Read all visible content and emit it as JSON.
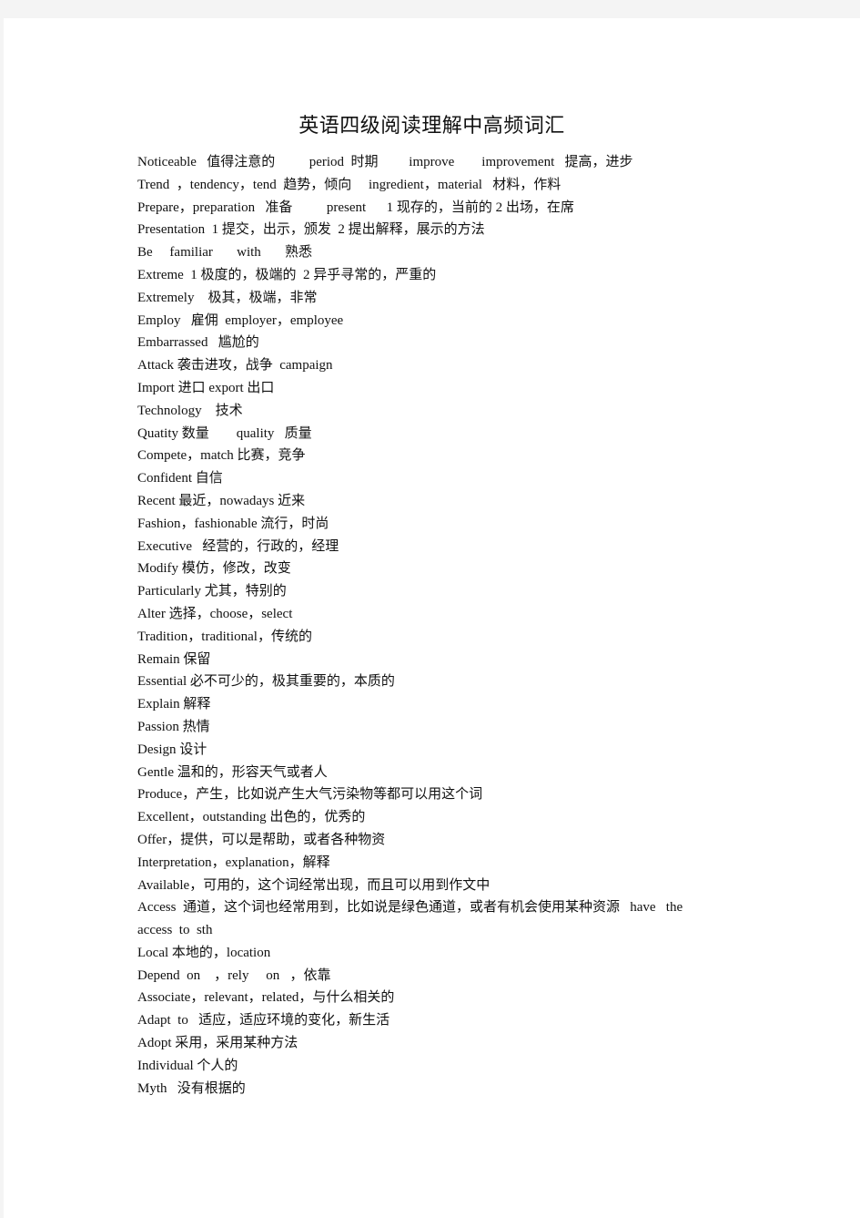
{
  "document": {
    "title": "英语四级阅读理解中高频词汇",
    "lines": [
      "Noticeable   值得注意的          period  时期         improve        improvement   提高，进步",
      "Trend  ，tendency，tend  趋势，倾向     ingredient，material   材料，作料",
      "Prepare，preparation   准备          present      1 现存的，当前的 2 出场，在席",
      "Presentation  1 提交，出示，颁发  2 提出解释，展示的方法",
      "Be     familiar       with       熟悉",
      "Extreme  1 极度的，极端的  2 异乎寻常的，严重的",
      "Extremely    极其，极端，非常",
      "Employ   雇佣  employer，employee",
      "Embarrassed   尴尬的",
      "Attack 袭击进攻，战争  campaign",
      "Import 进口 export 出口",
      "Technology    技术",
      "Quatity 数量        quality   质量",
      "Compete，match 比赛，竞争",
      "Confident 自信",
      "Recent 最近，nowadays 近来",
      "Fashion，fashionable 流行，时尚",
      "Executive   经营的，行政的，经理",
      "Modify 模仿，修改，改变",
      "Particularly 尤其，特别的",
      "Alter 选择，choose，select",
      "Tradition，traditional，传统的",
      "Remain 保留",
      "Essential 必不可少的，极其重要的，本质的",
      "Explain 解释",
      "Passion 热情",
      "Design 设计",
      "Gentle 温和的，形容天气或者人",
      "Produce，产生，比如说产生大气污染物等都可以用这个词",
      "Excellent，outstanding 出色的，优秀的",
      "Offer，提供，可以是帮助，或者各种物资",
      "Interpretation，explanation，解释",
      "Available，可用的，这个词经常出现，而且可以用到作文中",
      "Access  通道，这个词也经常用到，比如说是绿色通道，或者有机会使用某种资源   have   the",
      "access  to  sth",
      "Local 本地的，location",
      "Depend  on    ，rely     on   ，依靠",
      "Associate，relevant，related，与什么相关的",
      "Adapt  to   适应，适应环境的变化，新生活",
      "Adopt 采用，采用某种方法",
      "Individual 个人的",
      "Myth   没有根据的"
    ]
  }
}
